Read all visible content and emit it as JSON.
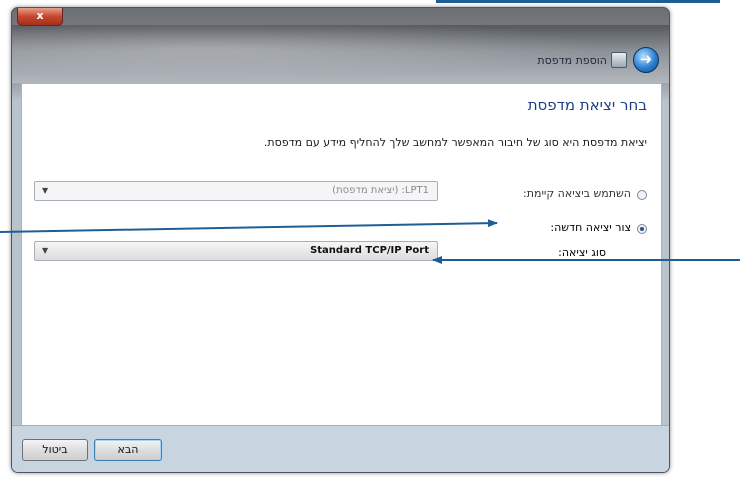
{
  "window": {
    "title": "הוספת מדפסת",
    "close_label": "x"
  },
  "page": {
    "heading": "בחר יציאת מדפסת",
    "description": "יציאת מדפסת היא סוג של חיבור המאפשר למחשב שלך להחליף מידע עם מדפסת."
  },
  "options": {
    "existing_label": "השתמש ביציאה קיימת:",
    "existing_value": "LPT1: (יציאת מדפסת)",
    "new_label": "צור יציאה חדשה:",
    "type_label": "סוג יציאה:",
    "type_value": "Standard TCP/IP Port",
    "selected": "new"
  },
  "buttons": {
    "next_label": "הבא",
    "cancel_label": "ביטול"
  },
  "colors": {
    "heading": "#1e3f87",
    "callout_arrow": "#1f5e95",
    "footer_bg": "#c8d4df"
  }
}
